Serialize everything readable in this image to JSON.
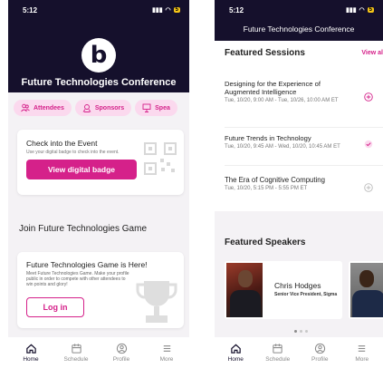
{
  "left": {
    "status": {
      "time": "5:12",
      "battery": "5"
    },
    "conference_title": "Future Technologies Conference",
    "chips": [
      {
        "label": "Attendees",
        "icon": "attendees-icon"
      },
      {
        "label": "Sponsors",
        "icon": "sponsors-icon"
      },
      {
        "label": "Spea",
        "icon": "speakers-icon"
      }
    ],
    "checkin": {
      "title": "Check into the Event",
      "subtitle": "Use your digital badge to check into the event.",
      "button": "View digital badge"
    },
    "game_section_title": "Join Future Technologies Game",
    "game": {
      "title": "Future Technologies Game is Here!",
      "description": "Meet Future Technologies Game. Make your profile public in order to compete with other attendees to win points and glory!",
      "button": "Log in"
    },
    "tabs": [
      {
        "label": "Home",
        "icon": "home-icon",
        "active": true
      },
      {
        "label": "Schedule",
        "icon": "calendar-icon",
        "active": false
      },
      {
        "label": "Profile",
        "icon": "profile-icon",
        "active": false
      },
      {
        "label": "More",
        "icon": "menu-icon",
        "active": false
      }
    ]
  },
  "right": {
    "status": {
      "time": "5:12",
      "battery": "5"
    },
    "conference_title": "Future Technologies Conference",
    "sessions_title": "Featured Sessions",
    "view_all": "View al",
    "sessions": [
      {
        "title": "Designing for the Experience of Augmented Intelligence",
        "time": "Tue, 10/20, 9:00 AM - Tue, 10/26, 10:00 AM ET",
        "state": "add"
      },
      {
        "title": "Future Trends in Technology",
        "time": "Tue, 10/20, 9:45 AM - Wed, 10/20, 10:45 AM ET",
        "state": "added"
      },
      {
        "title": "The Era of Cognitive Computing",
        "time": "Tue, 10/20, 5:15 PM - 5:55 PM ET",
        "state": "add-disabled"
      }
    ],
    "speakers_title": "Featured Speakers",
    "speakers": [
      {
        "name": "Chris Hodges",
        "role": "Senior Vice President, Sigma"
      }
    ],
    "tabs": [
      {
        "label": "Home",
        "icon": "home-icon",
        "active": true
      },
      {
        "label": "Schedule",
        "icon": "calendar-icon",
        "active": false
      },
      {
        "label": "Profile",
        "icon": "profile-icon",
        "active": false
      },
      {
        "label": "More",
        "icon": "menu-icon",
        "active": false
      }
    ]
  },
  "colors": {
    "brand_dark": "#15102c",
    "accent_pink": "#d5218a",
    "chip_bg": "#fbd9ee"
  }
}
